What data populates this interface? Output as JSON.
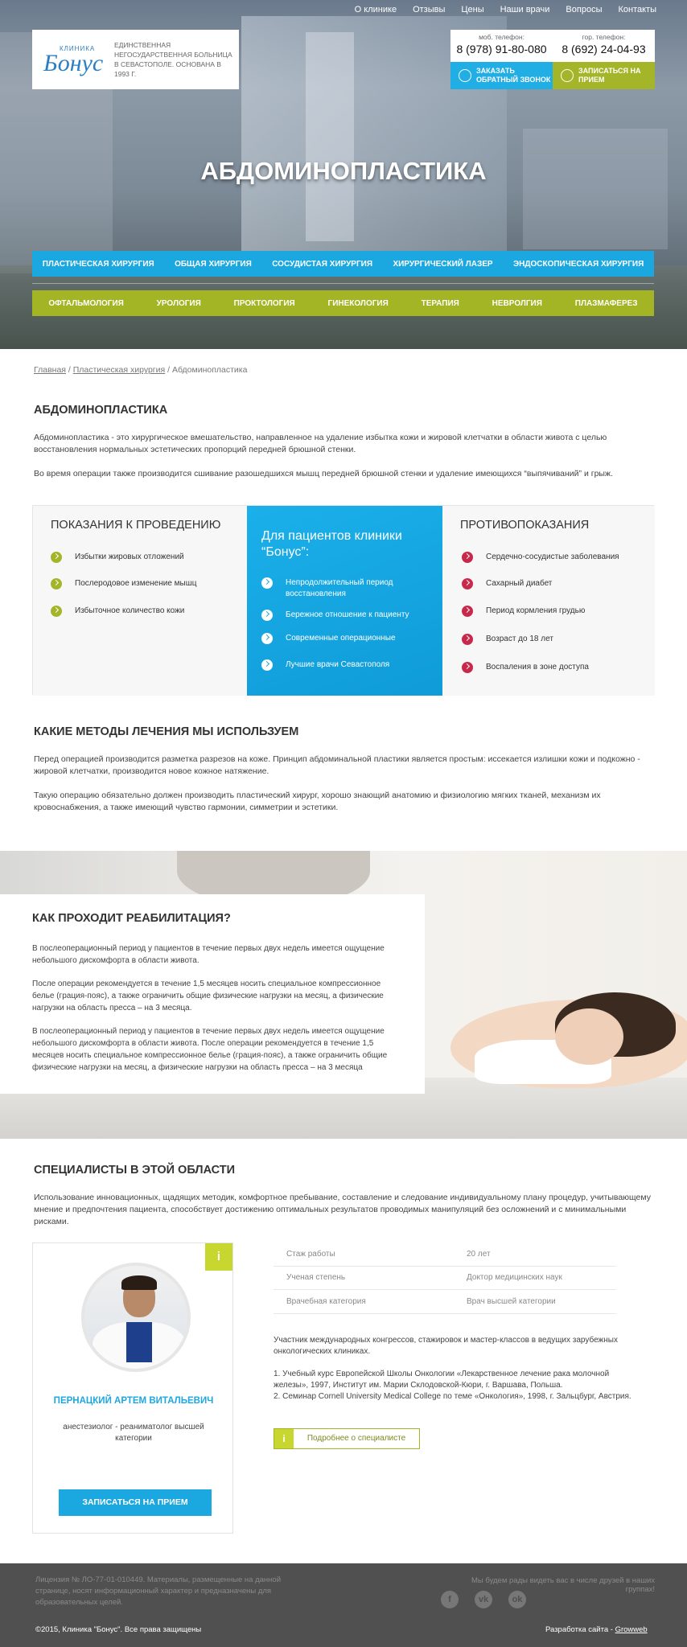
{
  "topnav": [
    "О клинике",
    "Отзывы",
    "Цены",
    "Наши врачи",
    "Вопросы",
    "Контакты"
  ],
  "logo": {
    "small": "КЛИНИКА",
    "brand": "Бонус",
    "desc": "ЕДИНСТВЕННАЯ НЕГОСУДАРСТВЕННАЯ БОЛЬНИЦА В СЕВАСТОПОЛЕ. ОСНОВАНА В 1993 Г."
  },
  "contacts": {
    "mobile_label": "моб. телефон:",
    "mobile": "8 (978) 91-80-080",
    "city_label": "гор. телефон:",
    "city": "8 (692) 24-04-93",
    "callback": "ЗАКАЗАТЬ ОБРАТНЫЙ ЗВОНОК",
    "appointment": "ЗАПИСАТЬСЯ НА ПРИЕМ"
  },
  "page_title": "АБДОМИНОПЛАСТИКА",
  "menu_primary": [
    "ПЛАСТИЧЕСКАЯ ХИРУРГИЯ",
    "ОБЩАЯ ХИРУРГИЯ",
    "СОСУДИСТАЯ ХИРУРГИЯ",
    "ХИРУРГИЧЕСКИЙ ЛАЗЕР",
    "ЭНДОСКОПИЧЕСКАЯ ХИРУРГИЯ"
  ],
  "menu_secondary": [
    "ОФТАЛЬМОЛОГИЯ",
    "УРОЛОГИЯ",
    "ПРОКТОЛОГИЯ",
    "ГИНЕКОЛОГИЯ",
    "ТЕРАПИЯ",
    "НЕВРОЛГИЯ",
    "ПЛАЗМАФЕРЕЗ"
  ],
  "breadcrumbs": {
    "home": "Главная",
    "section": "Пластическая хирургия",
    "current": "Абдоминопластика",
    "sep": " / "
  },
  "intro": {
    "heading": "АБДОМИНОПЛАСТИКА",
    "p1": "Абдоминопластика  - это хирургическое вмешательство, направленное на удаление избытка кожи и жировой клетчатки в области живота с целью восстановления нормальных эстетических пропорций передней брюшной стенки.",
    "p2": "Во время операции также производится сшивание разошедшихся мышц передней брюшной стенки и удаление имеющихся “выпячиваний” и грыж."
  },
  "indications": {
    "title": "ПОКАЗАНИЯ К ПРОВЕДЕНИЮ",
    "items": [
      "Избытки жировых отложений",
      "Послеродовое изменение мышц",
      "Избыточное количество кожи"
    ]
  },
  "patients": {
    "title": "Для пациентов клиники “Бонус”:",
    "items": [
      "Непродолжительный период восстановления",
      "Бережное отношение к пациенту",
      "Современные операционные",
      "Лучшие врачи Севастополя"
    ]
  },
  "contra": {
    "title": "ПРОТИВОПОКАЗАНИЯ",
    "items": [
      "Сердечно-сосудистые заболевания",
      "Сахарный диабет",
      "Период  кормления грудью",
      "Возраст до 18 лет",
      "Воспаления в зоне доступа"
    ]
  },
  "methods": {
    "heading": "КАКИЕ МЕТОДЫ ЛЕЧЕНИЯ МЫ ИСПОЛЬЗУЕМ",
    "p1": "Перед операцией производится разметка разрезов на коже. Принцип абдоминальной пластики является простым: иссекается излишки кожи и подкожно - жировой клетчатки, производится новое кожное натяжение.",
    "p2": "Такую операцию обязательно должен производить пластический хирург, хорошо знающий анатомию и физиологию мягких тканей, механизм их кровоснабжения, а также имеющий чувство гармонии, симметрии и эстетики."
  },
  "rehab": {
    "heading": "КАК ПРОХОДИТ РЕАБИЛИТАЦИЯ?",
    "p1": "В послеоперационный период у пациентов в течение первых двух недель имеется ощущение небольшого дискомфорта в области живота.",
    "p2": "После операции рекомендуется в течение 1,5 месяцев носить специальное компрессионное белье (грация-пояс), а также ограничить общие физические нагрузки на месяц, а физические нагрузки на область пресса – на 3 месяца.",
    "p3": "В послеоперационный период у пациентов в течение первых двух недель имеется ощущение небольшого дискомфорта в области живота. После операции рекомендуется в течение 1,5 месяцев носить специальное компрессионное белье (грация-пояс), а также ограничить общие физические нагрузки на месяц, а физические нагрузки на область пресса – на 3 месяца"
  },
  "specialists": {
    "heading": "СПЕЦИАЛИСТЫ В ЭТОЙ ОБЛАСТИ",
    "intro": "Использование инновационных, щадящих методик, комфортное пребывание, составление и следование индивидуальному плану процедур, учитывающему мнение и предпочтения пациента, способствует достижению оптимальных результатов проводимых манипуляций без осложнений и с минимальными рисками.",
    "badge": "i",
    "name": "ПЕРНАЦКИЙ АРТЕМ ВИТАЛЬЕВИЧ",
    "position": "анестезиолог - реаниматолог высшей категории",
    "apply": "ЗАПИСАТЬСЯ НА ПРИЕМ",
    "stats": [
      {
        "k": "Стаж работы",
        "v": "20 лет"
      },
      {
        "k": "Ученая степень",
        "v": "Доктор медицинских наук"
      },
      {
        "k": "Врачебная категория",
        "v": "Врач высшей категории"
      }
    ],
    "bio_intro": "Участник международных конгрессов, стажировок и мастер-классов в ведущих зарубежных онкологических клиниках.",
    "bio_1": "1.      Учебный курс Европейской Школы Онкологии «Лекарственное лечение рака молочной железы», 1997, Институт им. Марии Склодовской-Кюри, г. Варшава, Польша.",
    "bio_2": "2.      Семинар Cornell University Medical College по теме «Онкология», 1998, г. Зальцбург, Австрия.",
    "more": "Подробнее о специалисте"
  },
  "footer": {
    "license": "Лицензия № ЛО-77-01-010449. Материалы, размещенные на данной странице, носят информационный характер и предназначены для образовательных целей.",
    "friends": "Мы будем рады видеть вас в числе друзей в наших группах!",
    "social": [
      "f",
      "vk",
      "ok"
    ],
    "copyright": "©2015, Клиника \"Бонус\". Все права защищены",
    "dev_label": "Разработка сайта - ",
    "dev_link": "Growweb"
  }
}
